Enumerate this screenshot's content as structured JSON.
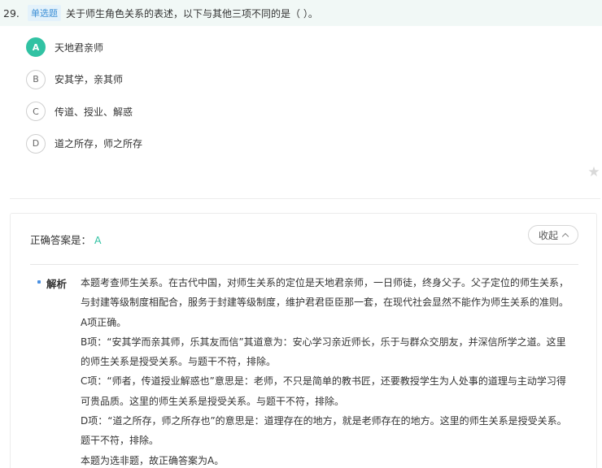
{
  "question": {
    "number": "29.",
    "type_badge": "单选题",
    "text": "关于师生角色关系的表述，以下与其他三项不同的是（   ）。"
  },
  "options": [
    {
      "letter": "A",
      "text": "天地君亲师",
      "selected": true
    },
    {
      "letter": "B",
      "text": "安其学，亲其师",
      "selected": false
    },
    {
      "letter": "C",
      "text": "传道、授业、解惑",
      "selected": false
    },
    {
      "letter": "D",
      "text": "道之所存，师之所存",
      "selected": false
    }
  ],
  "favorite_icon": "star-icon",
  "analysis": {
    "answer_label": "正确答案是：",
    "answer_value": "A",
    "collapse_label": "收起",
    "explain_label": "解析",
    "lines": [
      "本题考查师生关系。在古代中国，对师生关系的定位是天地君亲师，一日师徒，终身父子。父子定位的师生关系，与封建等级制度相配合，服务于封建等级制度，维护君君臣臣那一套，在现代社会显然不能作为师生关系的准则。",
      "A项正确。",
      "B项：“安其学而亲其师，乐其友而信”其道意为：安心学习亲近师长，乐于与群众交朋友，并深信所学之道。这里的师生关系是授受关系。与题干不符，排除。",
      "C项：“师者，传道授业解惑也”意思是：老师，不只是简单的教书匠，还要教授学生为人处事的道理与主动学习得可贵品质。这里的师生关系是授受关系。与题干不符，排除。",
      "D项：“道之所存，师之所存也”的意思是：道理存在的地方，就是老师存在的地方。这里的师生关系是授受关系。题干不符，排除。",
      "本题为选非题，故正确答案为A。"
    ]
  },
  "colors": {
    "accent": "#31c2a3",
    "badge_text": "#3c8fd6",
    "badge_bg": "#e4f2fb",
    "question_bar": "#f1f8f6"
  }
}
